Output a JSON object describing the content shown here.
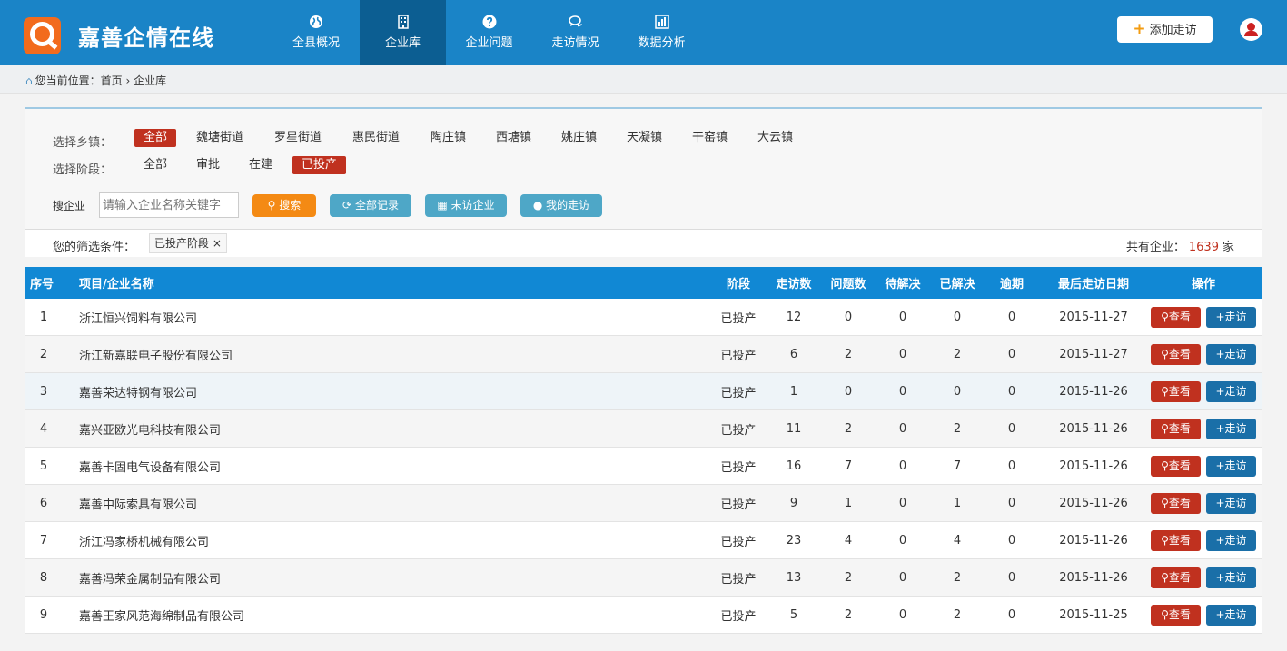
{
  "app": {
    "brand": "嘉善企情在线",
    "logo_letter": "Q",
    "brand_color": "#1a84c7",
    "accent": "#f26b1d"
  },
  "nav": [
    {
      "label": "全县概况",
      "icon": "globe-icon"
    },
    {
      "label": "企业库",
      "icon": "building-icon",
      "active": true
    },
    {
      "label": "企业问题",
      "icon": "question-circle-icon"
    },
    {
      "label": "走访情况",
      "icon": "comments-icon"
    },
    {
      "label": "数据分析",
      "icon": "bar-chart-icon"
    }
  ],
  "header": {
    "add_visit_label": "添加走访",
    "plus": "+",
    "user_icon": "user-icon"
  },
  "breadcrumb": {
    "prefix": "您当前位置：",
    "items": [
      "首页",
      "企业库"
    ],
    "sep": "›"
  },
  "filters": {
    "town_label": "选择乡镇：",
    "towns": [
      "全部",
      "魏塘街道",
      "罗星街道",
      "惠民街道",
      "陶庄镇",
      "西塘镇",
      "姚庄镇",
      "天凝镇",
      "干窑镇",
      "大云镇"
    ],
    "town_selected": 0,
    "stage_label": "选择阶段：",
    "stages": [
      "全部",
      "审批",
      "在建",
      "已投产"
    ],
    "stage_selected": 3
  },
  "search": {
    "label": "搜企业",
    "placeholder": "请输入企业名称关键字",
    "search_btn": "搜索",
    "all_records_btn": "全部记录",
    "unvisited_btn": "未访企业",
    "my_visits_btn": "我的走访"
  },
  "condition": {
    "label": "您的筛选条件：",
    "tag": "已投产阶段",
    "tag_close": "×",
    "total_prefix": "共有企业：",
    "total": "1639",
    "total_suffix": "家"
  },
  "table": {
    "headers": [
      "序号",
      "项目/企业名称",
      "阶段",
      "走访数",
      "问题数",
      "待解决",
      "已解决",
      "逾期",
      "最后走访日期",
      "操作"
    ],
    "view_label": "查看",
    "visit_label": "走访",
    "rows": [
      {
        "no": "1",
        "name": "浙江恒兴饲料有限公司",
        "stage": "已投产",
        "visits": "12",
        "issues": "0",
        "pending": "0",
        "solved": "0",
        "overdue": "0",
        "date": "2015-11-27"
      },
      {
        "no": "2",
        "name": "浙江新嘉联电子股份有限公司",
        "stage": "已投产",
        "visits": "6",
        "issues": "2",
        "pending": "0",
        "solved": "2",
        "overdue": "0",
        "date": "2015-11-27"
      },
      {
        "no": "3",
        "name": "嘉善荣达特钢有限公司",
        "stage": "已投产",
        "visits": "1",
        "issues": "0",
        "pending": "0",
        "solved": "0",
        "overdue": "0",
        "date": "2015-11-26"
      },
      {
        "no": "4",
        "name": "嘉兴亚欧光电科技有限公司",
        "stage": "已投产",
        "visits": "11",
        "issues": "2",
        "pending": "0",
        "solved": "2",
        "overdue": "0",
        "date": "2015-11-26"
      },
      {
        "no": "5",
        "name": "嘉善卡固电气设备有限公司",
        "stage": "已投产",
        "visits": "16",
        "issues": "7",
        "pending": "0",
        "solved": "7",
        "overdue": "0",
        "date": "2015-11-26"
      },
      {
        "no": "6",
        "name": "嘉善中际索具有限公司",
        "stage": "已投产",
        "visits": "9",
        "issues": "1",
        "pending": "0",
        "solved": "1",
        "overdue": "0",
        "date": "2015-11-26"
      },
      {
        "no": "7",
        "name": "浙江冯家桥机械有限公司",
        "stage": "已投产",
        "visits": "23",
        "issues": "4",
        "pending": "0",
        "solved": "4",
        "overdue": "0",
        "date": "2015-11-26"
      },
      {
        "no": "8",
        "name": "嘉善冯荣金属制品有限公司",
        "stage": "已投产",
        "visits": "13",
        "issues": "2",
        "pending": "0",
        "solved": "2",
        "overdue": "0",
        "date": "2015-11-26"
      },
      {
        "no": "9",
        "name": "嘉善王家风范海绵制品有限公司",
        "stage": "已投产",
        "visits": "5",
        "issues": "2",
        "pending": "0",
        "solved": "2",
        "overdue": "0",
        "date": "2015-11-25"
      }
    ]
  }
}
